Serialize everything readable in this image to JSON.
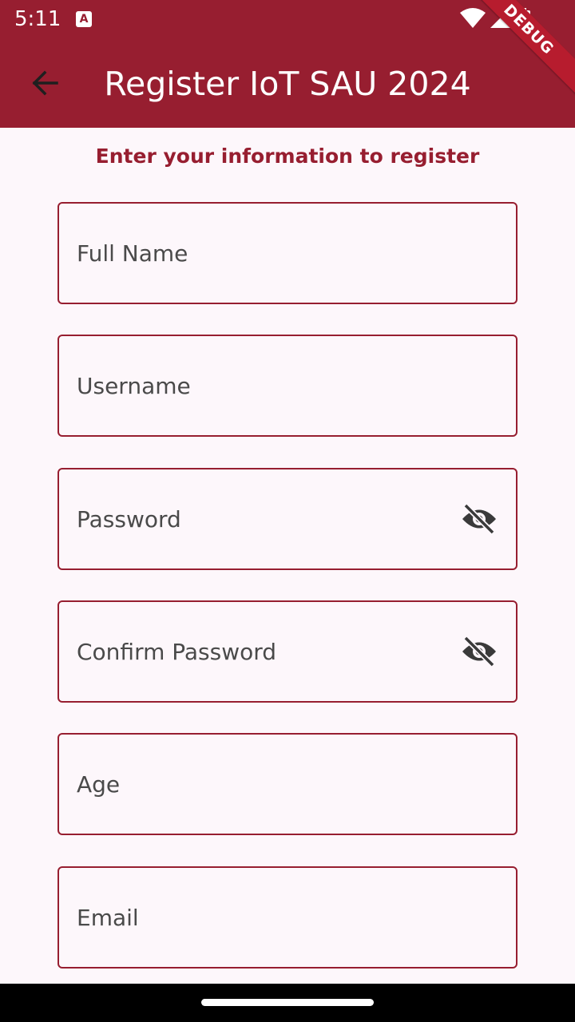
{
  "status_bar": {
    "time": "5:11",
    "app_icon_glyph": "A",
    "icons": [
      "app-notification-icon",
      "wifi-icon",
      "cellular-signal-icon",
      "battery-icon"
    ]
  },
  "app_bar": {
    "title": "Register IoT SAU 2024",
    "back_icon": "arrow-left-icon",
    "background_color": "#971e30",
    "debug_banner": "DEBUG"
  },
  "form": {
    "subtitle": "Enter your information to register",
    "accent_color": "#971e30",
    "fields": {
      "full_name": {
        "placeholder": "Full Name",
        "value": ""
      },
      "username": {
        "placeholder": "Username",
        "value": ""
      },
      "password": {
        "placeholder": "Password",
        "value": "",
        "trailing_icon": "visibility-off-icon"
      },
      "confirm_password": {
        "placeholder": "Confirm Password",
        "value": "",
        "trailing_icon": "visibility-off-icon"
      },
      "age": {
        "placeholder": "Age",
        "value": ""
      },
      "email": {
        "placeholder": "Email",
        "value": ""
      }
    }
  }
}
